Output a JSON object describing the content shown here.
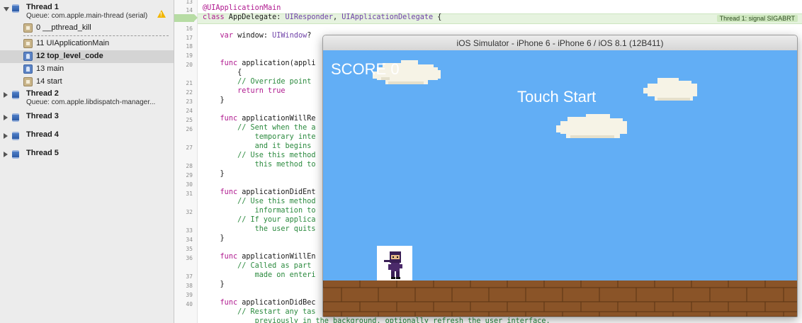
{
  "navigator": {
    "thread1": {
      "name": "Thread 1",
      "queue": "Queue: com.apple.main-thread (serial)",
      "frames": [
        {
          "label": "0 __pthread_kill",
          "icon": "system-frame-icon"
        },
        {
          "label": "11 UIApplicationMain",
          "icon": "system-frame-icon"
        },
        {
          "label": "12 top_level_code",
          "icon": "user-frame-icon",
          "selected": true
        },
        {
          "label": "13 main",
          "icon": "user-frame-icon"
        },
        {
          "label": "14 start",
          "icon": "system-frame-icon"
        }
      ]
    },
    "thread2": {
      "name": "Thread 2",
      "queue": "Queue: com.apple.libdispatch-manager..."
    },
    "thread3": {
      "name": "Thread 3"
    },
    "thread4": {
      "name": "Thread 4"
    },
    "thread5": {
      "name": "Thread 5"
    }
  },
  "editor": {
    "line_numbers": [
      "13",
      "14",
      "15",
      "16",
      "17",
      "18",
      "19",
      "20",
      "",
      "21",
      "22",
      "23",
      "24",
      "25",
      "26",
      "",
      "27",
      "",
      "28",
      "29",
      "30",
      "31",
      "",
      "32",
      "",
      "33",
      "34",
      "35",
      "36",
      "",
      "37",
      "38",
      "39",
      "40",
      ""
    ],
    "signal_badge": "Thread 1: signal SIGABRT",
    "lines": [
      {
        "segments": [
          {
            "t": "@UIApplicationMain",
            "c": "at"
          }
        ]
      },
      {
        "segments": [
          {
            "t": "class",
            "c": "kw"
          },
          {
            "t": " AppDelegate: ",
            "c": ""
          },
          {
            "t": "UIResponder",
            "c": "ty"
          },
          {
            "t": ", ",
            "c": ""
          },
          {
            "t": "UIApplicationDelegate",
            "c": "ty"
          },
          {
            "t": " {",
            "c": ""
          }
        ]
      },
      {
        "segments": [
          {
            "t": "",
            "c": ""
          }
        ]
      },
      {
        "segments": [
          {
            "t": "    ",
            "c": ""
          },
          {
            "t": "var",
            "c": "kw"
          },
          {
            "t": " window: ",
            "c": ""
          },
          {
            "t": "UIWindow",
            "c": "ty"
          },
          {
            "t": "?",
            "c": ""
          }
        ]
      },
      {
        "segments": [
          {
            "t": "",
            "c": ""
          }
        ]
      },
      {
        "segments": [
          {
            "t": "",
            "c": ""
          }
        ]
      },
      {
        "segments": [
          {
            "t": "    ",
            "c": ""
          },
          {
            "t": "func",
            "c": "kw"
          },
          {
            "t": " application(appli",
            "c": ""
          }
        ]
      },
      {
        "segments": [
          {
            "t": "        {",
            "c": ""
          }
        ]
      },
      {
        "segments": [
          {
            "t": "        ",
            "c": ""
          },
          {
            "t": "// Override point",
            "c": "cm"
          }
        ]
      },
      {
        "segments": [
          {
            "t": "        ",
            "c": ""
          },
          {
            "t": "return",
            "c": "kw"
          },
          {
            "t": " ",
            "c": ""
          },
          {
            "t": "true",
            "c": "kw"
          }
        ]
      },
      {
        "segments": [
          {
            "t": "    }",
            "c": ""
          }
        ]
      },
      {
        "segments": [
          {
            "t": "",
            "c": ""
          }
        ]
      },
      {
        "segments": [
          {
            "t": "    ",
            "c": ""
          },
          {
            "t": "func",
            "c": "kw"
          },
          {
            "t": " applicationWillRe",
            "c": ""
          }
        ]
      },
      {
        "segments": [
          {
            "t": "        ",
            "c": ""
          },
          {
            "t": "// Sent when the a",
            "c": "cm"
          }
        ]
      },
      {
        "segments": [
          {
            "t": "            ",
            "c": ""
          },
          {
            "t": "temporary inte",
            "c": "cm"
          }
        ]
      },
      {
        "segments": [
          {
            "t": "            ",
            "c": ""
          },
          {
            "t": "and it begins",
            "c": "cm"
          }
        ]
      },
      {
        "segments": [
          {
            "t": "        ",
            "c": ""
          },
          {
            "t": "// Use this method",
            "c": "cm"
          }
        ]
      },
      {
        "segments": [
          {
            "t": "            ",
            "c": ""
          },
          {
            "t": "this method to",
            "c": "cm"
          }
        ]
      },
      {
        "segments": [
          {
            "t": "    }",
            "c": ""
          }
        ]
      },
      {
        "segments": [
          {
            "t": "",
            "c": ""
          }
        ]
      },
      {
        "segments": [
          {
            "t": "    ",
            "c": ""
          },
          {
            "t": "func",
            "c": "kw"
          },
          {
            "t": " applicationDidEnt",
            "c": ""
          }
        ]
      },
      {
        "segments": [
          {
            "t": "        ",
            "c": ""
          },
          {
            "t": "// Use this method",
            "c": "cm"
          }
        ]
      },
      {
        "segments": [
          {
            "t": "            ",
            "c": ""
          },
          {
            "t": "information to",
            "c": "cm"
          }
        ]
      },
      {
        "segments": [
          {
            "t": "        ",
            "c": ""
          },
          {
            "t": "// If your applica",
            "c": "cm"
          }
        ]
      },
      {
        "segments": [
          {
            "t": "            ",
            "c": ""
          },
          {
            "t": "the user quits",
            "c": "cm"
          }
        ]
      },
      {
        "segments": [
          {
            "t": "    }",
            "c": ""
          }
        ]
      },
      {
        "segments": [
          {
            "t": "",
            "c": ""
          }
        ]
      },
      {
        "segments": [
          {
            "t": "    ",
            "c": ""
          },
          {
            "t": "func",
            "c": "kw"
          },
          {
            "t": " applicationWillEn",
            "c": ""
          }
        ]
      },
      {
        "segments": [
          {
            "t": "        ",
            "c": ""
          },
          {
            "t": "// Called as part",
            "c": "cm"
          }
        ]
      },
      {
        "segments": [
          {
            "t": "            ",
            "c": ""
          },
          {
            "t": "made on enteri",
            "c": "cm"
          }
        ]
      },
      {
        "segments": [
          {
            "t": "    }",
            "c": ""
          }
        ]
      },
      {
        "segments": [
          {
            "t": "",
            "c": ""
          }
        ]
      },
      {
        "segments": [
          {
            "t": "    ",
            "c": ""
          },
          {
            "t": "func",
            "c": "kw"
          },
          {
            "t": " applicationDidBec",
            "c": ""
          }
        ]
      },
      {
        "segments": [
          {
            "t": "        ",
            "c": ""
          },
          {
            "t": "// Restart any tas",
            "c": "cm"
          }
        ]
      },
      {
        "segments": [
          {
            "t": "            ",
            "c": ""
          },
          {
            "t": "previously in the background, optionally refresh the user interface.",
            "c": "cm"
          }
        ]
      }
    ]
  },
  "simulator": {
    "title": "iOS Simulator - iPhone 6 - iPhone 6 / iOS 8.1 (12B411)",
    "score_text": "SCORE 0",
    "prompt_text": "Touch Start",
    "colors": {
      "sky": "#62aef5",
      "ground": "#8a5428",
      "brick_line": "#5a3414"
    }
  }
}
